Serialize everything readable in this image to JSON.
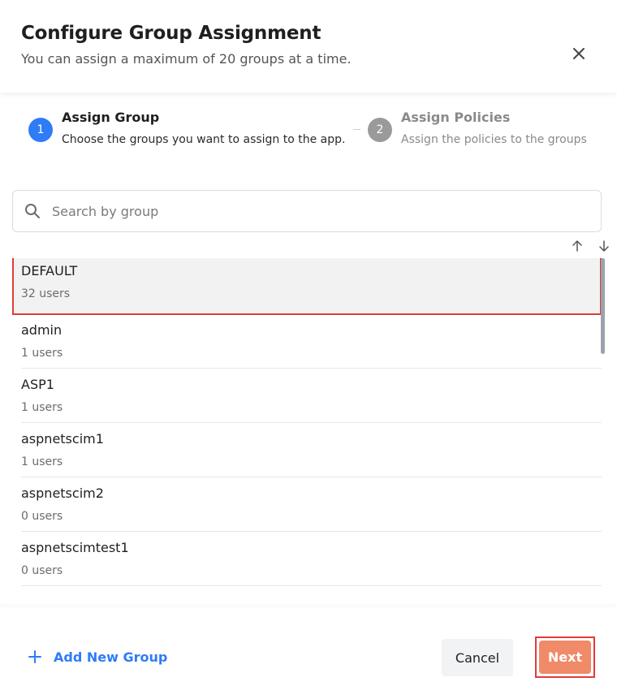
{
  "dialog": {
    "title": "Configure Group Assignment",
    "subtitle": "You can assign a maximum of 20 groups at a time.",
    "close_icon": "close-icon"
  },
  "steps": [
    {
      "number": "1",
      "title": "Assign Group",
      "description": "Choose the groups you want to assign to the app.",
      "state": "active",
      "color": "#2e7cf6"
    },
    {
      "number": "2",
      "title": "Assign Policies",
      "description": "Assign the policies to the groups",
      "state": "inactive",
      "color": "#9a9a9a"
    }
  ],
  "search": {
    "placeholder": "Search by group",
    "value": "",
    "icon": "search-icon"
  },
  "sort": {
    "up_icon": "arrow-up-icon",
    "down_icon": "arrow-down-icon"
  },
  "groups": [
    {
      "name": "DEFAULT",
      "users": "32 users",
      "selected": true
    },
    {
      "name": "admin",
      "users": "1 users",
      "selected": false
    },
    {
      "name": "ASP1",
      "users": "1 users",
      "selected": false
    },
    {
      "name": "aspnetscim1",
      "users": "1 users",
      "selected": false
    },
    {
      "name": "aspnetscim2",
      "users": "0 users",
      "selected": false
    },
    {
      "name": "aspnetscimtest1",
      "users": "0 users",
      "selected": false
    }
  ],
  "footer": {
    "add_group_label": "Add New Group",
    "add_icon": "plus-icon",
    "cancel_label": "Cancel",
    "next_label": "Next"
  },
  "colors": {
    "primary": "#2e7cf6",
    "next_button": "#f08a68",
    "highlight": "#e03b3b"
  }
}
